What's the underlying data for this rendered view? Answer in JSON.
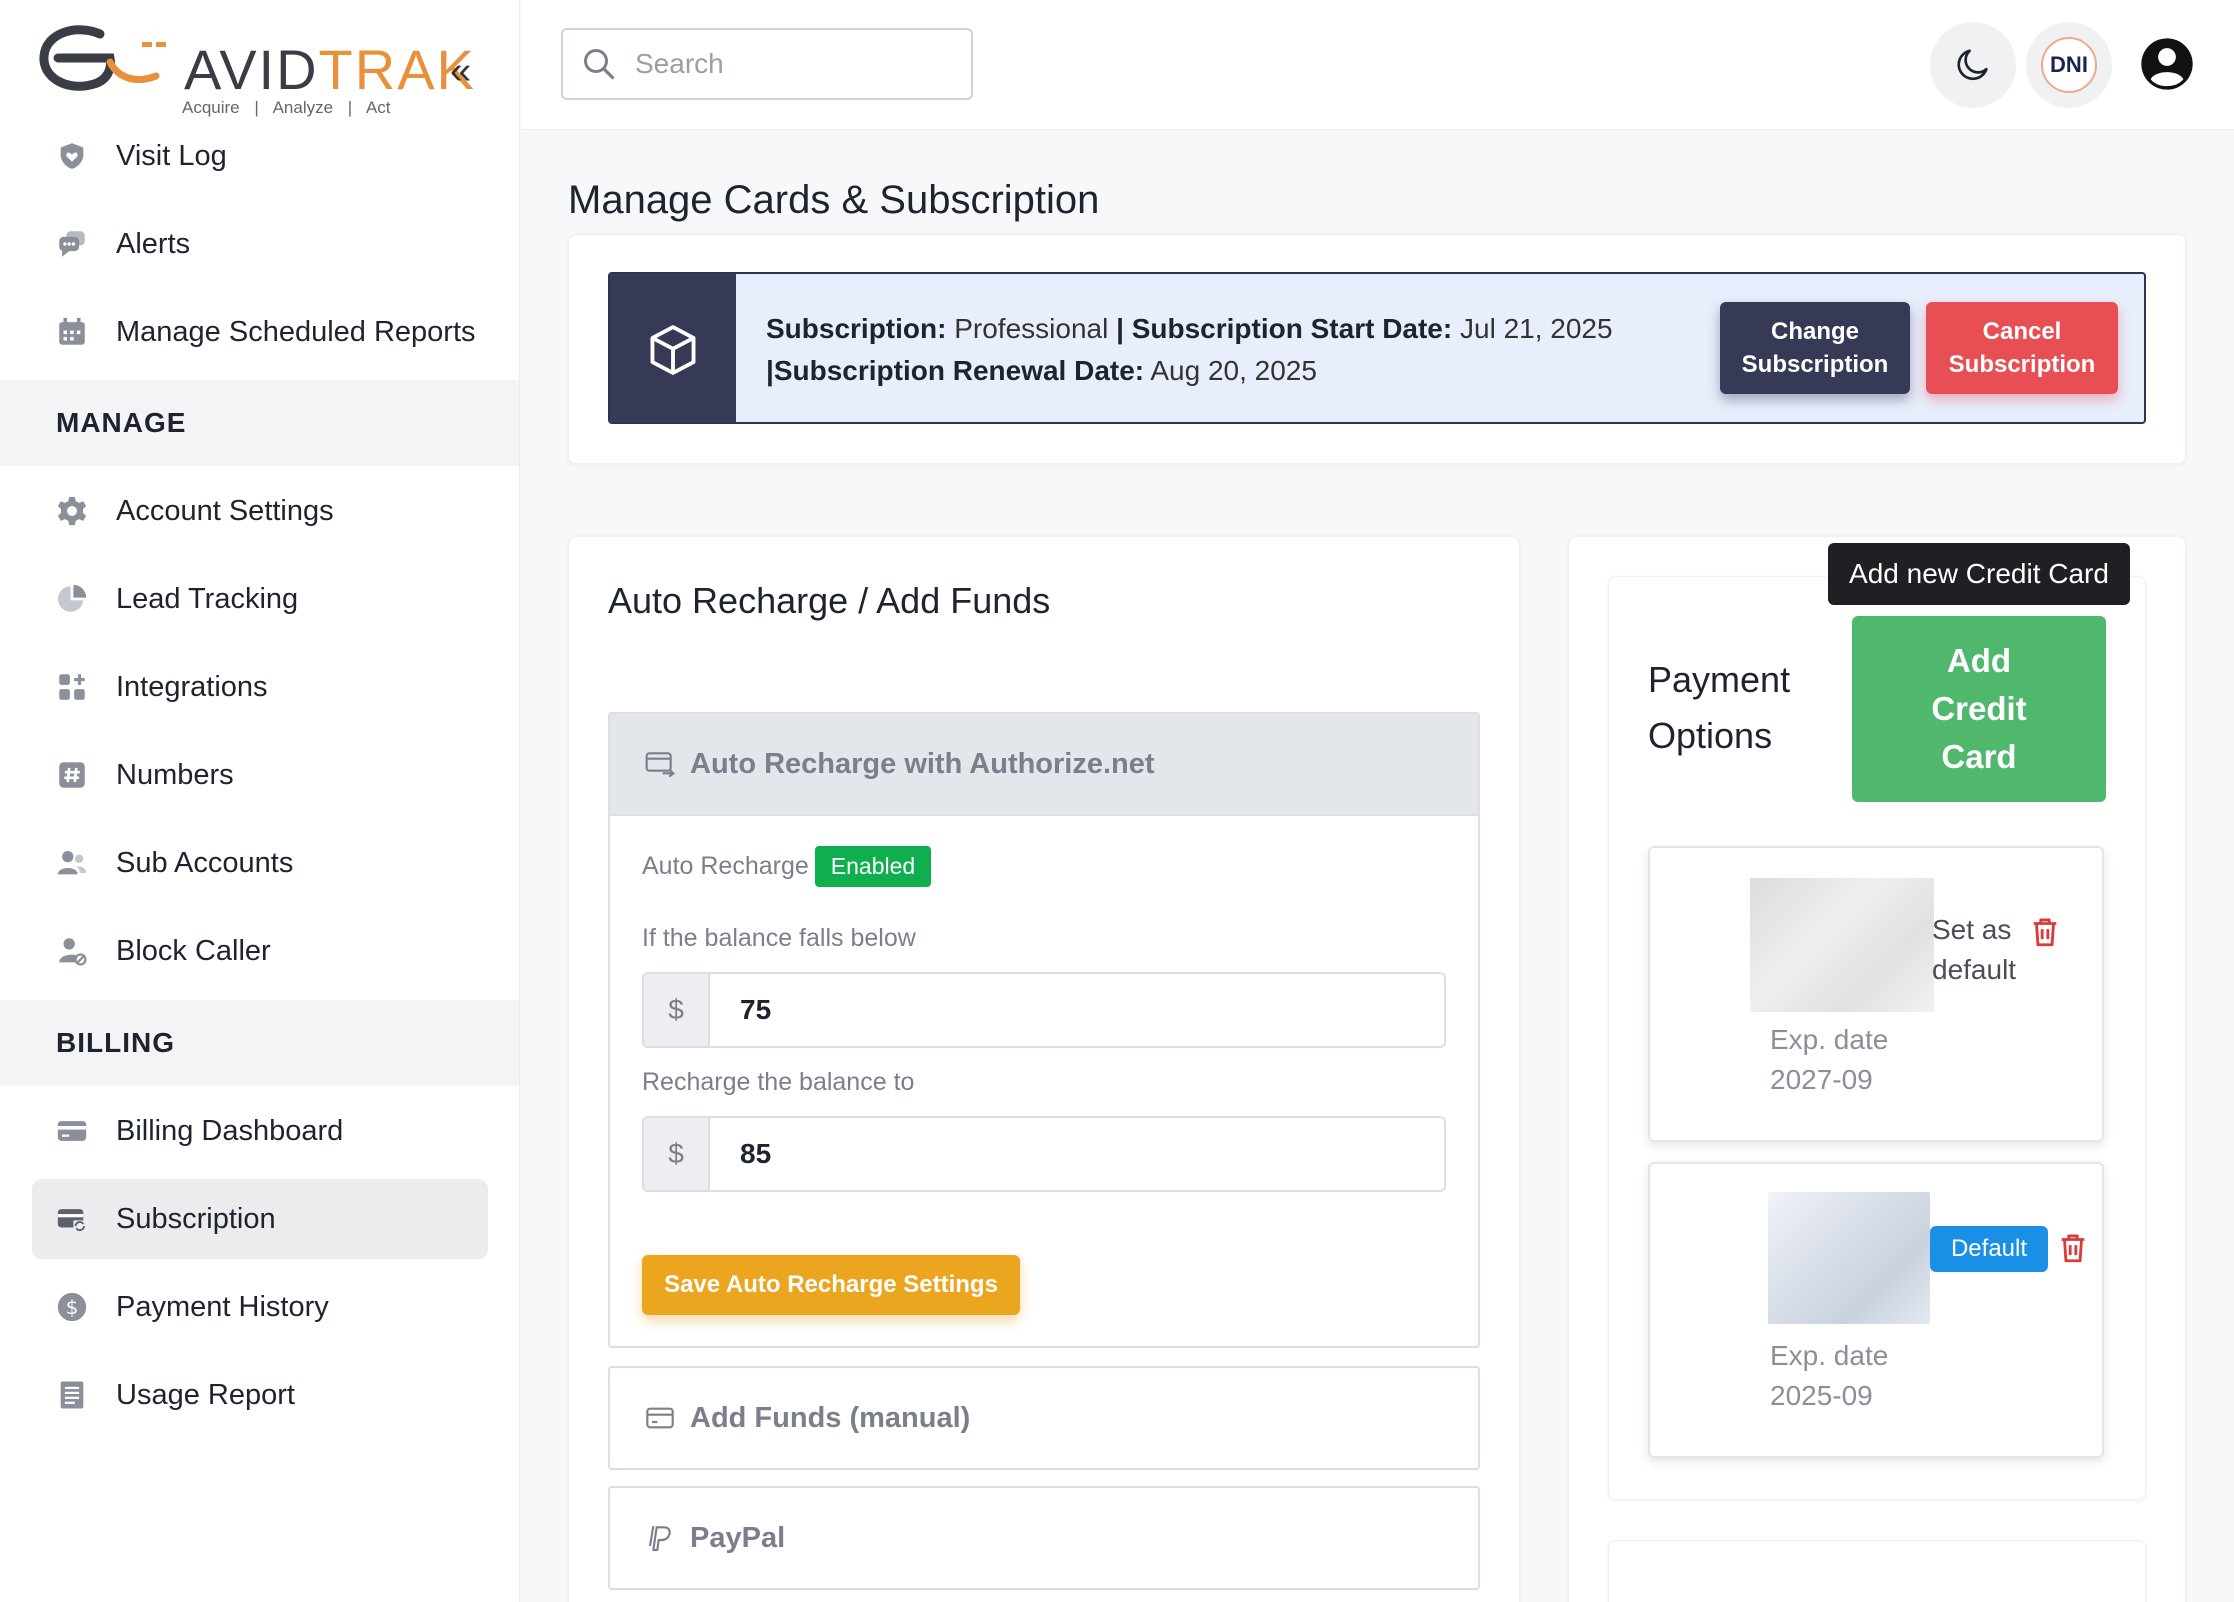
{
  "brand": {
    "name_part1": "AVID",
    "name_part2": "TRAK",
    "tagline": "Acquire | Analyze | Act",
    "accent_color": "#e8913a"
  },
  "sidebar": {
    "collapse_icon": "chevrons-left-icon",
    "items_top": [
      {
        "label": "Visit Log",
        "icon": "heart-shield-icon"
      },
      {
        "label": "Alerts",
        "icon": "chat-bubbles-icon"
      },
      {
        "label": "Manage Scheduled Reports",
        "icon": "calendar-icon"
      }
    ],
    "manage_heading": "MANAGE",
    "manage_items": [
      {
        "label": "Account Settings",
        "icon": "gear-icon"
      },
      {
        "label": "Lead Tracking",
        "icon": "pie-chart-icon"
      },
      {
        "label": "Integrations",
        "icon": "grid-plus-icon"
      },
      {
        "label": "Numbers",
        "icon": "hash-icon"
      },
      {
        "label": "Sub Accounts",
        "icon": "users-icon"
      },
      {
        "label": "Block Caller",
        "icon": "user-block-icon"
      }
    ],
    "billing_heading": "BILLING",
    "billing_items": [
      {
        "label": "Billing Dashboard",
        "icon": "credit-card-icon"
      },
      {
        "label": "Subscription",
        "icon": "card-refresh-icon",
        "active": true
      },
      {
        "label": "Payment History",
        "icon": "dollar-circle-icon"
      },
      {
        "label": "Usage Report",
        "icon": "document-list-icon"
      }
    ]
  },
  "topbar": {
    "search_placeholder": "Search",
    "dni_label": "DNI"
  },
  "page": {
    "title": "Manage Cards & Subscription"
  },
  "subscription": {
    "plan_label": "Subscription:",
    "plan_value": "Professional",
    "start_label": "| Subscription Start Date:",
    "start_value": "Jul 21, 2025",
    "renewal_label": "|Subscription Renewal Date:",
    "renewal_value": "Aug 20, 2025",
    "change_btn_line1": "Change",
    "change_btn_line2": "Subscription",
    "cancel_btn_line1": "Cancel",
    "cancel_btn_line2": "Subscription"
  },
  "auto_recharge": {
    "section_title": "Auto Recharge / Add Funds",
    "panel_title": "Auto Recharge with Authorize.net",
    "status_label": "Auto Recharge",
    "status_badge": "Enabled",
    "threshold_label": "If the balance falls below",
    "threshold_currency": "$",
    "threshold_value": "75",
    "recharge_label": "Recharge the balance to",
    "recharge_currency": "$",
    "recharge_value": "85",
    "save_button": "Save Auto Recharge Settings",
    "add_funds_title": "Add Funds (manual)",
    "paypal_title": "PayPal"
  },
  "payment_options": {
    "title_line1": "Payment",
    "title_line2": "Options",
    "tooltip": "Add new Credit Card",
    "add_btn_line1": "Add",
    "add_btn_line2": "Credit",
    "add_btn_line3": "Card",
    "cards": [
      {
        "set_default_line1": "Set as",
        "set_default_line2": "default",
        "exp_label": "Exp. date",
        "exp_value": "2027-09"
      },
      {
        "default_badge": "Default",
        "exp_label": "Exp. date",
        "exp_value": "2025-09"
      }
    ]
  },
  "colors": {
    "navy": "#363a57",
    "danger": "#e84f55",
    "success": "#0fae4e",
    "warning": "#eca51f",
    "green_button": "#4fb86d",
    "info": "#1a8fe6"
  }
}
